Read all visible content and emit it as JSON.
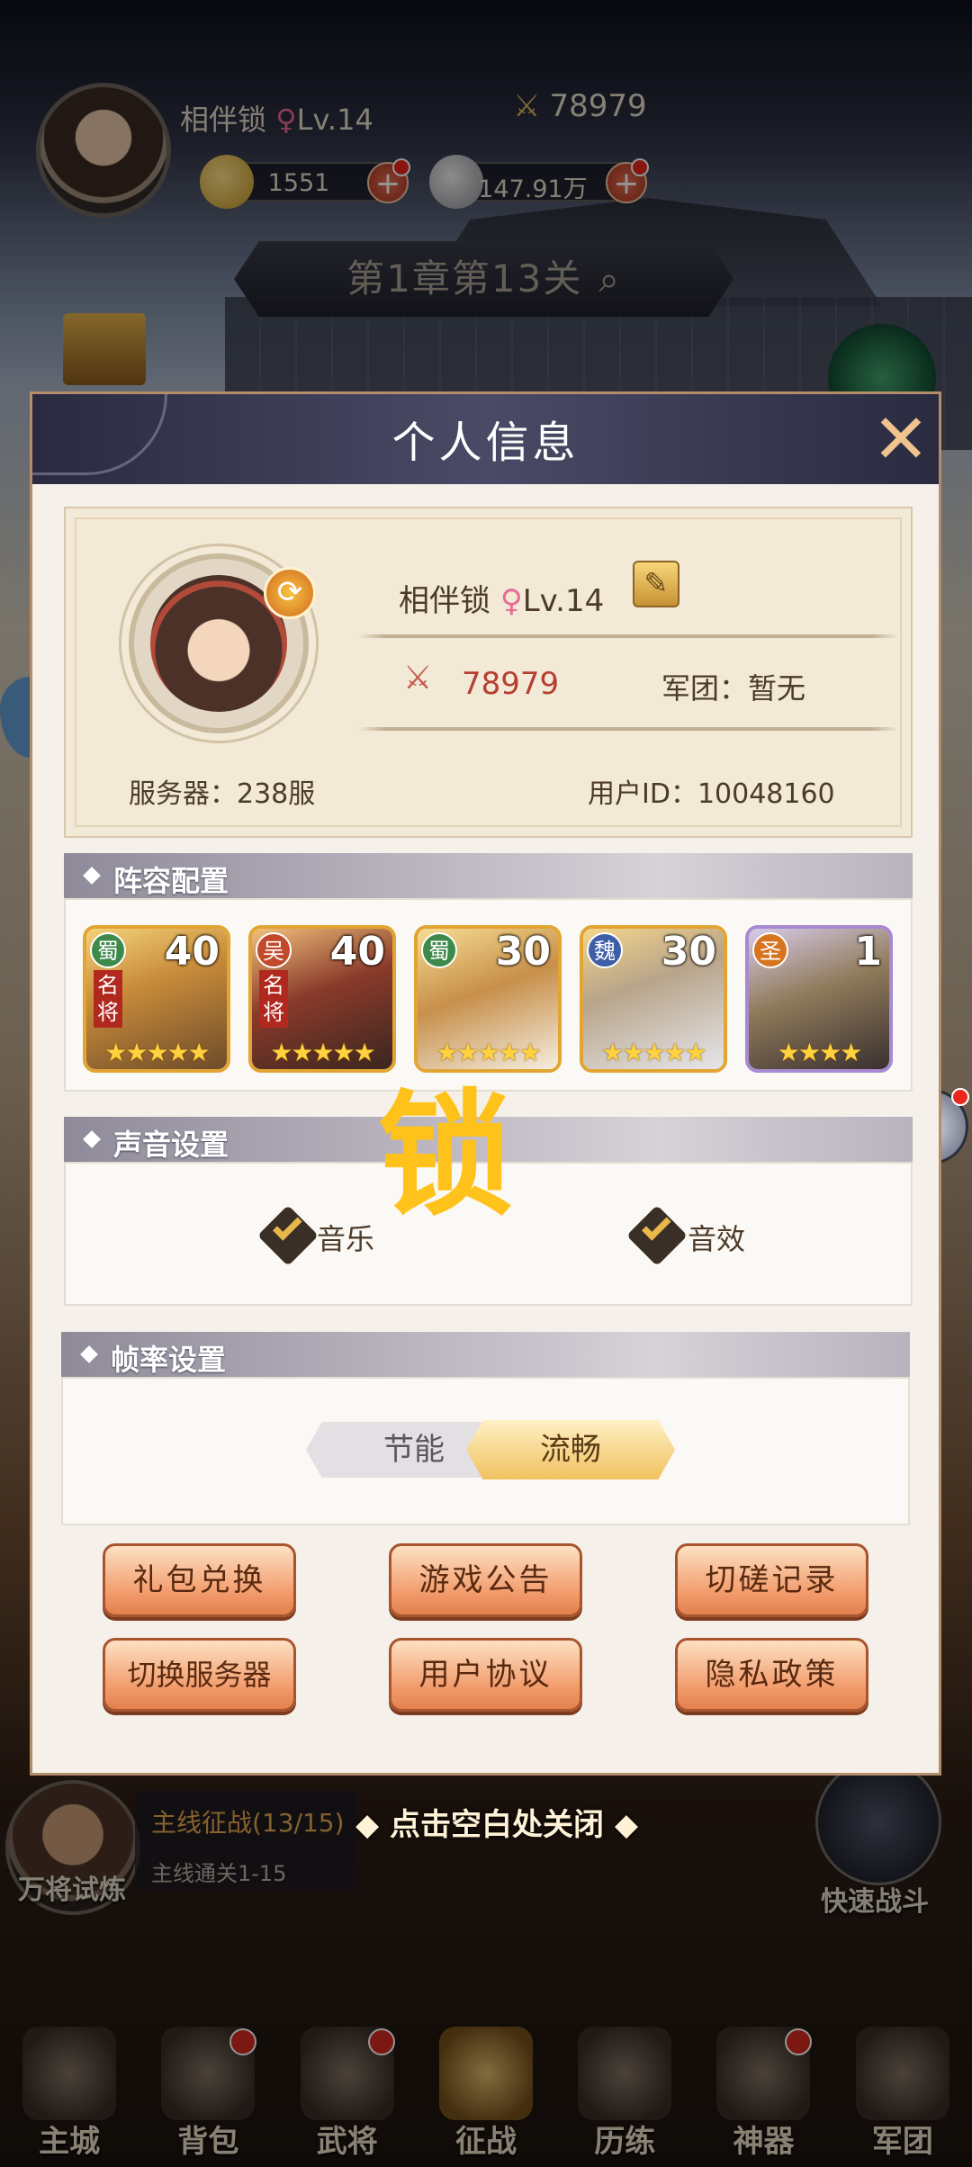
{
  "hud": {
    "player_name": "相伴锁",
    "gender_icon": "female-icon",
    "level": "Lv.14",
    "power": "78979",
    "gold": "1551",
    "silver": "147.91万",
    "chapter": "第1章第13关"
  },
  "modal": {
    "title": "个人信息",
    "close_glyph": "✕",
    "profile": {
      "name": "相伴锁",
      "level": "Lv.14",
      "power": "78979",
      "legion": "军团：暂无",
      "server": "服务器：238服",
      "user_id": "用户ID：10048160"
    },
    "team": {
      "title": "阵容配置",
      "heroes": [
        {
          "faction": "蜀",
          "level": "40",
          "tag": "名将",
          "stars": "★★★★★",
          "faction_color": "#3d8a4a"
        },
        {
          "faction": "吴",
          "level": "40",
          "tag": "名将",
          "stars": "★★★★★",
          "faction_color": "#c14a2a"
        },
        {
          "faction": "蜀",
          "level": "30",
          "tag": "",
          "stars": "★★★★★",
          "faction_color": "#3d8a4a"
        },
        {
          "faction": "魏",
          "level": "30",
          "tag": "",
          "stars": "★★★★★",
          "faction_color": "#3f5ea8"
        },
        {
          "faction": "圣",
          "level": "1",
          "tag": "",
          "stars": "★★★★",
          "faction_color": "#d7741f"
        }
      ]
    },
    "sound": {
      "title": "声音设置",
      "music": "音乐",
      "sfx": "音效",
      "music_checked": true,
      "sfx_checked": true
    },
    "watermark": "锁",
    "fps": {
      "title": "帧率设置",
      "option_save": "节能",
      "option_smooth": "流畅",
      "selected": "流畅"
    },
    "buttons": {
      "gift": "礼包兑换",
      "notice": "游戏公告",
      "duel": "切磋记录",
      "server": "切换服务器",
      "agreement": "用户协议",
      "privacy": "隐私政策"
    }
  },
  "scene": {
    "boss_label": "万将试炼",
    "quest_title": "主线征战(13/15)",
    "quest_sub": "主线通关1-15",
    "close_hint": "点击空白处关闭",
    "quick_battle": "快速战斗"
  },
  "nav": [
    {
      "label": "主城",
      "icon": "city-icon",
      "dot": false
    },
    {
      "label": "背包",
      "icon": "bag-icon",
      "dot": true
    },
    {
      "label": "武将",
      "icon": "general-icon",
      "dot": true
    },
    {
      "label": "征战",
      "icon": "battle-icon",
      "dot": false,
      "active": true
    },
    {
      "label": "历练",
      "icon": "scroll-icon",
      "dot": false
    },
    {
      "label": "神器",
      "icon": "artifact-icon",
      "dot": true
    },
    {
      "label": "军团",
      "icon": "legion-icon",
      "dot": false
    }
  ],
  "colors": {
    "accent_gold": "#e8b84a",
    "power_red": "#b63e32",
    "button_orange": "#f29a6a",
    "female_pink": "#e86a95"
  }
}
